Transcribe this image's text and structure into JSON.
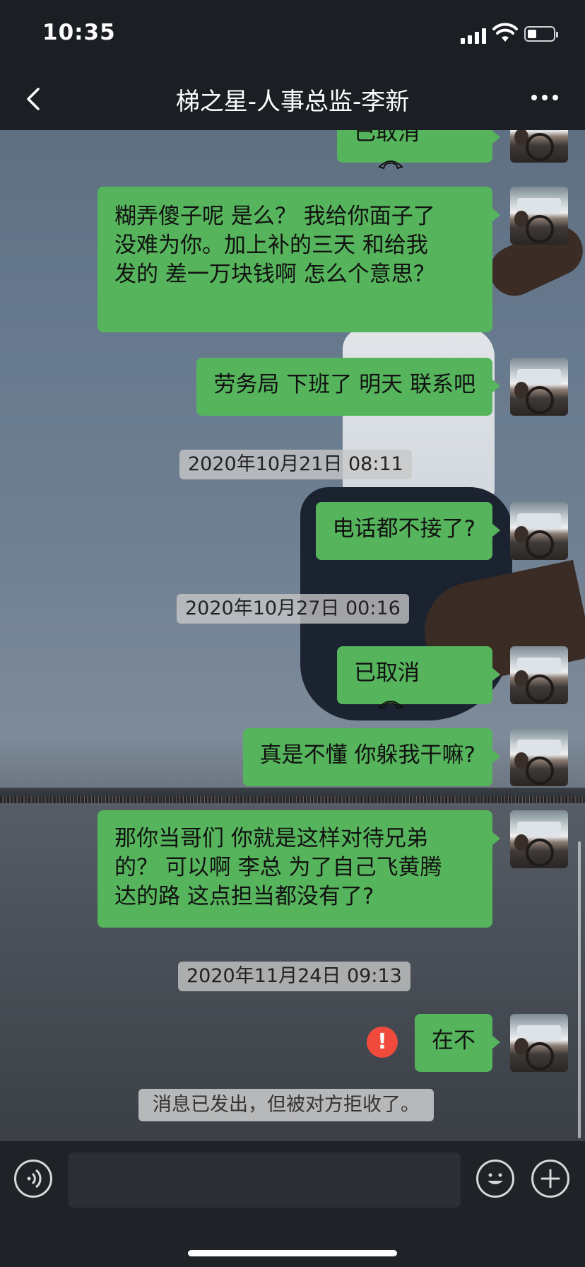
{
  "status_bar": {
    "time": "10:35",
    "battery_level": 0.35
  },
  "header": {
    "title": "梯之星-人事总监-李新"
  },
  "messages": [
    {
      "type": "call",
      "text": "已取消",
      "icon": "phone-hangup-icon"
    },
    {
      "type": "text",
      "lines": [
        "糊弄傻子呢 是么？ 我给你面子了",
        "没难为你。加上补的三天 和给我",
        "发的 差一万块钱啊  怎么个意思？"
      ]
    },
    {
      "type": "text",
      "text": "劳务局 下班了 明天 联系吧"
    },
    {
      "type": "time",
      "text": "2020年10月21日 08:11"
    },
    {
      "type": "text",
      "text": "电话都不接了?"
    },
    {
      "type": "time",
      "text": "2020年10月27日 00:16"
    },
    {
      "type": "call",
      "text": "已取消",
      "icon": "phone-hangup-icon"
    },
    {
      "type": "text",
      "text": "真是不懂 你躲我干嘛?"
    },
    {
      "type": "text",
      "lines": [
        "那你当哥们 你就是这样对待兄弟",
        "的？ 可以啊 李总 为了自己飞黄腾",
        "达的路 这点担当都没有了?"
      ]
    },
    {
      "type": "time",
      "text": "2020年11月24日 09:13"
    },
    {
      "type": "text",
      "text": "在不",
      "failed": true,
      "error_mark": "!"
    },
    {
      "type": "notice",
      "text": "消息已发出，但被对方拒收了。"
    }
  ],
  "input_bar": {
    "voice_icon": "voice-icon",
    "emoji_icon": "emoji-icon",
    "plus_icon": "plus-icon"
  },
  "colors": {
    "bubble": "#56b55c",
    "error": "#f04a3c",
    "bar": "#1b1f24"
  }
}
